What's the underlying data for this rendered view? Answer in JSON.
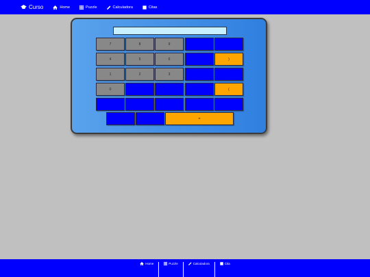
{
  "nav": {
    "brand": "Curso",
    "links": [
      "Home",
      "Puzzle",
      "Calculadora",
      "Citas"
    ]
  },
  "calculator": {
    "display_value": "",
    "keys": {
      "k7": "7",
      "k8": "8",
      "k9": "9",
      "k4": "4",
      "k5": "5",
      "k6": "6",
      "k1": "1",
      "k2": "2",
      "k3": "3",
      "k0": "0",
      "open_paren": "(",
      "close_paren": ")",
      "equals": "="
    }
  },
  "footer": {
    "links": [
      "Home",
      "Puzzle",
      "Calculadora",
      "Cita"
    ]
  },
  "colors": {
    "nav_bg": "#0000ff",
    "key_gray": "#888888",
    "key_blue": "#0000ff",
    "key_orange": "#ffa500",
    "page_bg": "#c0c0c0"
  }
}
